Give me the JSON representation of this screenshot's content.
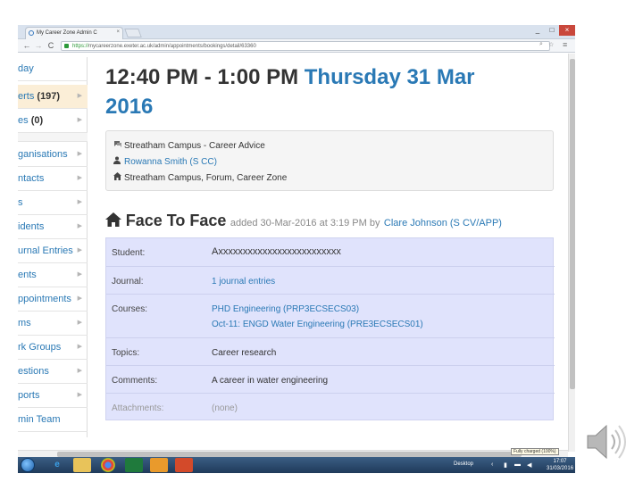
{
  "browser": {
    "tab_title": "My Career Zone Admin C",
    "tab_close": "×",
    "url_scheme": "https://",
    "url_rest": "mycareerzone.exeter.ac.uk/admin/appointments/bookings/detail/63360",
    "back": "←",
    "forward": "→",
    "reload": "C",
    "zoom_glyph": "⌕",
    "star_glyph": "☆",
    "menu_glyph": "≡",
    "min": "_",
    "max": "□",
    "close": "×"
  },
  "sidebar": {
    "items": [
      {
        "label": "day",
        "count": "",
        "arrow": ""
      },
      {
        "label": "erts ",
        "count": "(197)",
        "arrow": "▶"
      },
      {
        "label": "es ",
        "count": "(0)",
        "arrow": "▶"
      },
      {
        "label": "ganisations",
        "count": "",
        "arrow": "▶"
      },
      {
        "label": "ntacts",
        "count": "",
        "arrow": "▶"
      },
      {
        "label": "s",
        "count": "",
        "arrow": "▶"
      },
      {
        "label": "idents",
        "count": "",
        "arrow": "▶"
      },
      {
        "label": "urnal Entries",
        "count": "",
        "arrow": "▶"
      },
      {
        "label": "ents",
        "count": "",
        "arrow": "▶"
      },
      {
        "label": "ppointments",
        "count": "",
        "arrow": "▶"
      },
      {
        "label": "ms",
        "count": "",
        "arrow": "▶"
      },
      {
        "label": "rk Groups",
        "count": "",
        "arrow": "▶"
      },
      {
        "label": "estions",
        "count": "",
        "arrow": "▶"
      },
      {
        "label": "ports",
        "count": "",
        "arrow": "▶"
      },
      {
        "label": "min Team",
        "count": "",
        "arrow": ""
      }
    ]
  },
  "appointment": {
    "time": "12:40 PM - 1:00 PM",
    "date_line1": "Thursday 31 Mar",
    "date_line2": "2016",
    "info": {
      "service": "Streatham Campus - Career Advice",
      "adviser": "Rowanna Smith (S CC)",
      "location": "Streatham Campus, Forum, Career Zone"
    },
    "type": "Face To Face",
    "added_text": "added 30-Mar-2016 at 3:19 PM by",
    "added_by": "Clare Johnson (S CV/APP)",
    "details": [
      {
        "label": "Student:",
        "value": "Axxxxxxxxxxxxxxxxxxxxxxxxx",
        "value2": ""
      },
      {
        "label": "Journal:",
        "value": "1 journal entries",
        "value2": ""
      },
      {
        "label": "Courses:",
        "value": "PHD Engineering (PRP3ECSECS03)",
        "value2": "Oct-11: ENGD Water Engineering (PRE3ECSECS01)"
      },
      {
        "label": "Topics:",
        "value": "Career research",
        "value2": ""
      },
      {
        "label": "Comments:",
        "value": "A career in water engineering",
        "value2": ""
      },
      {
        "label": "Attachments:",
        "value": "(none)",
        "value2": ""
      }
    ]
  },
  "taskbar": {
    "desktop_label": "Desktop",
    "clock_time": "17:07",
    "clock_date": "31/03/2016",
    "tooltip": "Fully charged (100%)"
  },
  "colors": {
    "link": "#2a79b5",
    "detail_bg": "#e0e3fc",
    "active_sidebar": "#fbeed7"
  }
}
